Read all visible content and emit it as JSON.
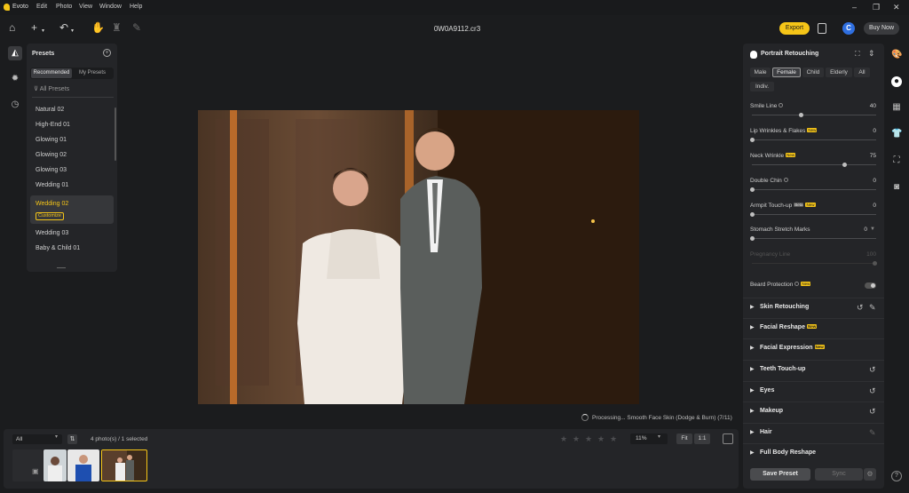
{
  "app": {
    "name": "Evoto"
  },
  "menu": [
    "Edit",
    "Photo",
    "View",
    "Window",
    "Help"
  ],
  "toolbar": {
    "filename": "0W0A9112.cr3",
    "export_label": "Export",
    "avatar_letter": "C",
    "buy_label": "Buy Now"
  },
  "presets": {
    "title": "Presets",
    "tabs": [
      "Recommended",
      "My Presets"
    ],
    "all_label": "All Presets",
    "items": [
      "Natural 02",
      "High-End 01",
      "Glowing 01",
      "Glowing 02",
      "Glowing 03",
      "Wedding 01"
    ],
    "selected": {
      "name": "Wedding 02",
      "badge": "Customize"
    },
    "items_after": [
      "Wedding 03",
      "Baby & Child 01"
    ]
  },
  "status": {
    "processing": "Processing... Smooth Face Skin (Dodge & Burn) (7/11)"
  },
  "bottom": {
    "filter_value": "All",
    "count_text": "4 photo(s) / 1 selected",
    "zoom": "11%",
    "fit_label": "Fit",
    "one_label": "1:1",
    "rating": 0,
    "stars_total": 5
  },
  "panel": {
    "title": "Portrait Retouching",
    "genders": [
      "Male",
      "Female",
      "Child",
      "Elderly",
      "All",
      "Indiv."
    ],
    "gender_selected": "Female",
    "sliders": [
      {
        "label": "Smile Line",
        "value": "40",
        "level": 0.4,
        "info": true,
        "badge": ""
      },
      {
        "label": "Lip Wrinkles & Flakes",
        "value": "0",
        "level": 0,
        "info": false,
        "badge": "New"
      },
      {
        "label": "Neck Wrinkle",
        "value": "75",
        "level": 0.75,
        "info": false,
        "badge": "New"
      },
      {
        "label": "Double Chin",
        "value": "0",
        "level": 0,
        "info": true,
        "badge": ""
      },
      {
        "label": "Armpit Touch-up",
        "value": "0",
        "level": 0,
        "info": false,
        "badge": "Beta",
        "badge2": "New"
      },
      {
        "label": "Stomach Stretch Marks",
        "value": "0",
        "level": 0,
        "info": false,
        "badge": ""
      },
      {
        "label": "Pregnancy Line",
        "value": "100",
        "level": 1,
        "info": false,
        "badge": "",
        "disabled": true
      }
    ],
    "beard": {
      "label": "Beard Protection",
      "badge": "New"
    },
    "sections": [
      {
        "label": "Skin Retouching",
        "badge": "",
        "icon": "reset-icon"
      },
      {
        "label": "Facial Reshape",
        "badge": "New",
        "icon": ""
      },
      {
        "label": "Facial Expression",
        "badge": "New",
        "icon": ""
      },
      {
        "label": "Teeth Touch-up",
        "badge": "",
        "icon": "reset-icon"
      },
      {
        "label": "Eyes",
        "badge": "",
        "icon": "reset-icon"
      },
      {
        "label": "Makeup",
        "badge": "",
        "icon": "reset-icon"
      },
      {
        "label": "Hair",
        "badge": "",
        "icon": "edit-icon"
      },
      {
        "label": "Full Body Reshape",
        "badge": "",
        "icon": ""
      }
    ],
    "save_label": "Save Preset",
    "sync_label": "Sync"
  },
  "colors": {
    "accent": "#f5c518",
    "avatar": "#2f6fe0",
    "panel_bg": "#242528"
  }
}
